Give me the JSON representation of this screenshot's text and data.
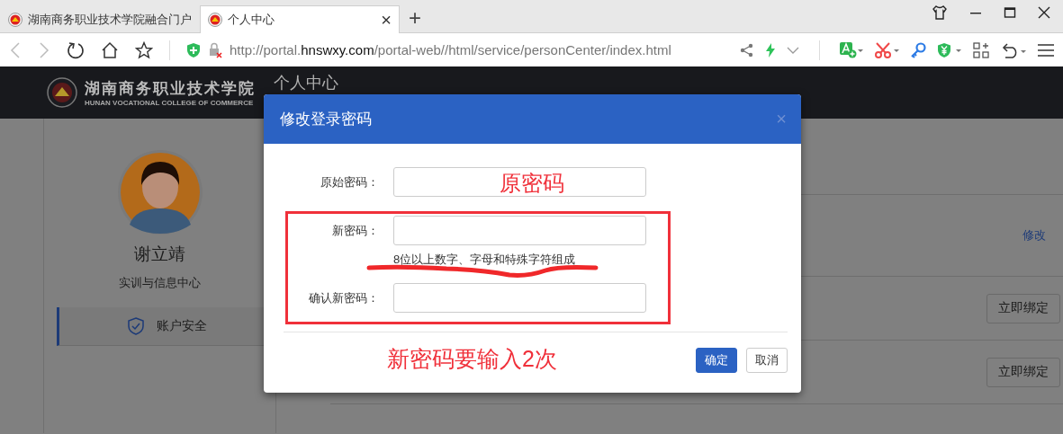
{
  "browser": {
    "tabs": [
      {
        "title": "湖南商务职业技术学院融合门户",
        "selected": false
      },
      {
        "title": "个人中心",
        "selected": true
      }
    ],
    "close_tab": "×",
    "new_tab": "+",
    "address": {
      "prefix": "http://portal.",
      "domain": "hnswxy.com",
      "path": "/portal-web//html/service/personCenter/index.html"
    }
  },
  "header": {
    "school_name": "湖南商务职业技术学院",
    "school_english": "HUNAN VOCATIONAL COLLEGE OF COMMERCE",
    "page_title": "个人中心"
  },
  "profile": {
    "name": "谢立靖",
    "department": "实训与信息中心"
  },
  "menu": [
    {
      "label": "账户安全",
      "selected": true
    }
  ],
  "rows": [
    {
      "kind": "empty"
    },
    {
      "kind": "link",
      "action": "修改"
    },
    {
      "kind": "button",
      "action": "立即绑定"
    },
    {
      "kind": "button",
      "action": "立即绑定"
    }
  ],
  "dialog": {
    "title": "修改登录密码",
    "close": "×",
    "fields": [
      {
        "label": "原始密码："
      },
      {
        "label": "新密码：",
        "hint": "8位以上数字、字母和特殊字符组成"
      },
      {
        "label": "确认新密码："
      }
    ],
    "buttons": [
      {
        "kind": "primary",
        "label": "确定"
      },
      {
        "kind": "default",
        "label": "取消"
      }
    ],
    "annotations": {
      "field_note": "原密码",
      "footer_note": "新密码要输入2次"
    }
  }
}
